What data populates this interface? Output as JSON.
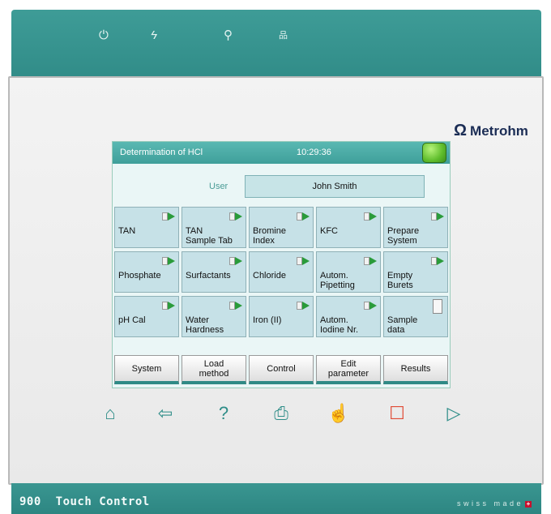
{
  "device": {
    "model": "900  Touch Control",
    "brand": "Metrohm",
    "swiss_made": "swiss made",
    "top_icons": [
      {
        "name": "power-icon",
        "glyph": "⏻"
      },
      {
        "name": "lightning-icon",
        "glyph": "ϟ"
      },
      {
        "name": "usb-icon",
        "glyph": "⚲"
      },
      {
        "name": "network-icon",
        "glyph": "品"
      }
    ],
    "accent_color": "#2f8a86"
  },
  "screen": {
    "title": "Determination of HCl",
    "time": "10:29:36",
    "status_led_color": "#5fbd2c",
    "user_label": "User",
    "user_value": "John Smith",
    "tiles": [
      {
        "label": "TAN",
        "icon": "method-start-icon"
      },
      {
        "label": "TAN\nSample Tab",
        "icon": "method-start-icon"
      },
      {
        "label": "Bromine\nIndex",
        "icon": "method-start-icon"
      },
      {
        "label": "KFC",
        "icon": "method-start-icon"
      },
      {
        "label": "Prepare\nSystem",
        "icon": "method-start-icon"
      },
      {
        "label": "Phosphate",
        "icon": "method-start-icon"
      },
      {
        "label": "Surfactants",
        "icon": "method-start-icon"
      },
      {
        "label": "Chloride",
        "icon": "method-start-icon"
      },
      {
        "label": "Autom.\nPipetting",
        "icon": "method-start-icon"
      },
      {
        "label": "Empty\nBurets",
        "icon": "method-start-icon"
      },
      {
        "label": "pH Cal",
        "icon": "method-start-icon"
      },
      {
        "label": "Water\nHardness",
        "icon": "method-start-icon"
      },
      {
        "label": "Iron (II)",
        "icon": "method-start-icon"
      },
      {
        "label": "Autom.\nIodine Nr.",
        "icon": "method-start-icon"
      },
      {
        "label": "Sample\ndata",
        "icon": "document-icon"
      }
    ],
    "function_buttons": [
      "System",
      "Load\nmethod",
      "Control",
      "Edit\nparameter",
      "Results"
    ]
  },
  "hardware_buttons": [
    {
      "name": "home-button",
      "glyph": "⌂"
    },
    {
      "name": "back-button",
      "glyph": "⇦"
    },
    {
      "name": "help-button",
      "glyph": "?"
    },
    {
      "name": "print-button",
      "glyph": "⎙"
    },
    {
      "name": "manual-control-button",
      "glyph": "☝"
    },
    {
      "name": "stop-button",
      "glyph": "☐"
    },
    {
      "name": "start-button",
      "glyph": "▷"
    }
  ]
}
